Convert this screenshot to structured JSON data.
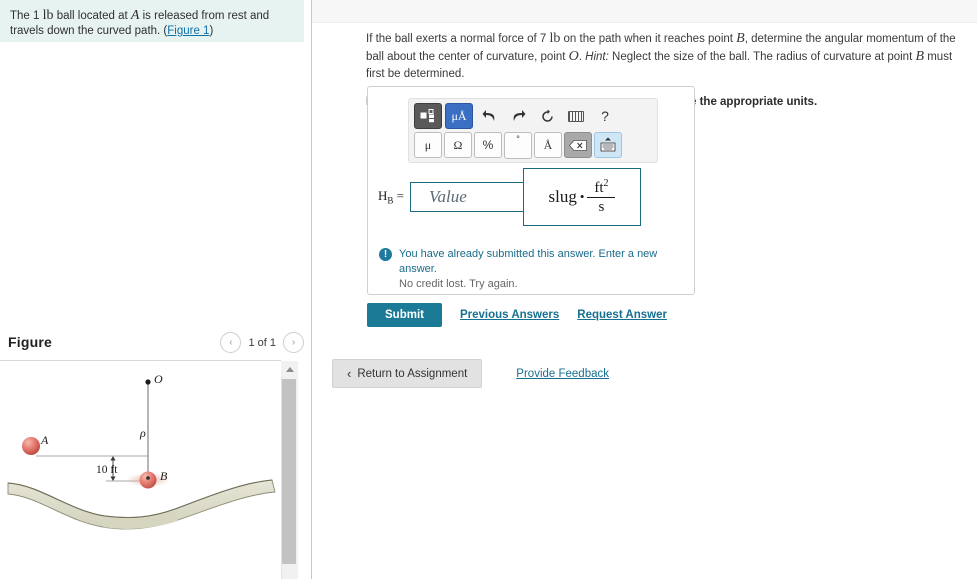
{
  "problem": {
    "statement_pre": "The 1 ",
    "statement_unit": "lb",
    "statement_mid": " ball located at ",
    "statement_point": "A",
    "statement_post": " is released from rest and travels down the curved path. (",
    "figure_link": "Figure 1",
    "statement_end": ")"
  },
  "question": {
    "line1_a": "If the ball exerts a normal force of 7 ",
    "line1_unit": "lb",
    "line1_b": " on the path when it reaches point ",
    "line1_point": "B",
    "line1_c": ", determine the angular momentum of the ball about the center of curvature, point ",
    "line1_point2": "O",
    "line1_d": ". ",
    "hint_label": "Hint:",
    "hint_text": " Neglect the size of the ball. The radius of curvature at point ",
    "hint_point": "B",
    "hint_end": " must first be determined.",
    "express": "Express your answer to three significant figures and include the appropriate units."
  },
  "toolbar": {
    "template_icon": "math-template-icon",
    "units_label": "μÅ",
    "undo_icon": "←",
    "redo_icon": "→",
    "reset_icon": "↻",
    "keyboard_icon": "keyboard-icon",
    "help_label": "?",
    "mu_label": "μ",
    "omega_label": "Ω",
    "percent_label": "%",
    "degree_label": "°",
    "angstrom_label": "Å",
    "backspace_icon": "backspace-icon",
    "keyboard2_icon": "keyboard-toggle-icon"
  },
  "answer": {
    "symbol": "H",
    "subscript": "B",
    "equals": "=",
    "placeholder": "Value",
    "value": "",
    "unit_slug": "slug",
    "unit_dot": "•",
    "unit_num": "ft",
    "unit_num_exp": "2",
    "unit_den": "s"
  },
  "feedback": {
    "icon": "alert-icon",
    "line1": "You have already submitted this answer. Enter a new answer.",
    "line2": "No credit lost. Try again."
  },
  "actions": {
    "submit": "Submit",
    "previous_answers": "Previous Answers",
    "request_answer": "Request Answer"
  },
  "bottom": {
    "return": "Return to Assignment",
    "back_arrow": "‹",
    "provide_feedback": "Provide Feedback"
  },
  "figure": {
    "title": "Figure",
    "prev_arrow": "‹",
    "next_arrow": "›",
    "counter": "1 of 1",
    "labels": {
      "point_o": "O",
      "point_a": "A",
      "point_b": "B",
      "rho": "ρ",
      "dimension": "10 ft"
    },
    "colors": {
      "ball": "#e06a60",
      "terrain": "#dcdbc8",
      "accent": "#1b7a96"
    }
  }
}
